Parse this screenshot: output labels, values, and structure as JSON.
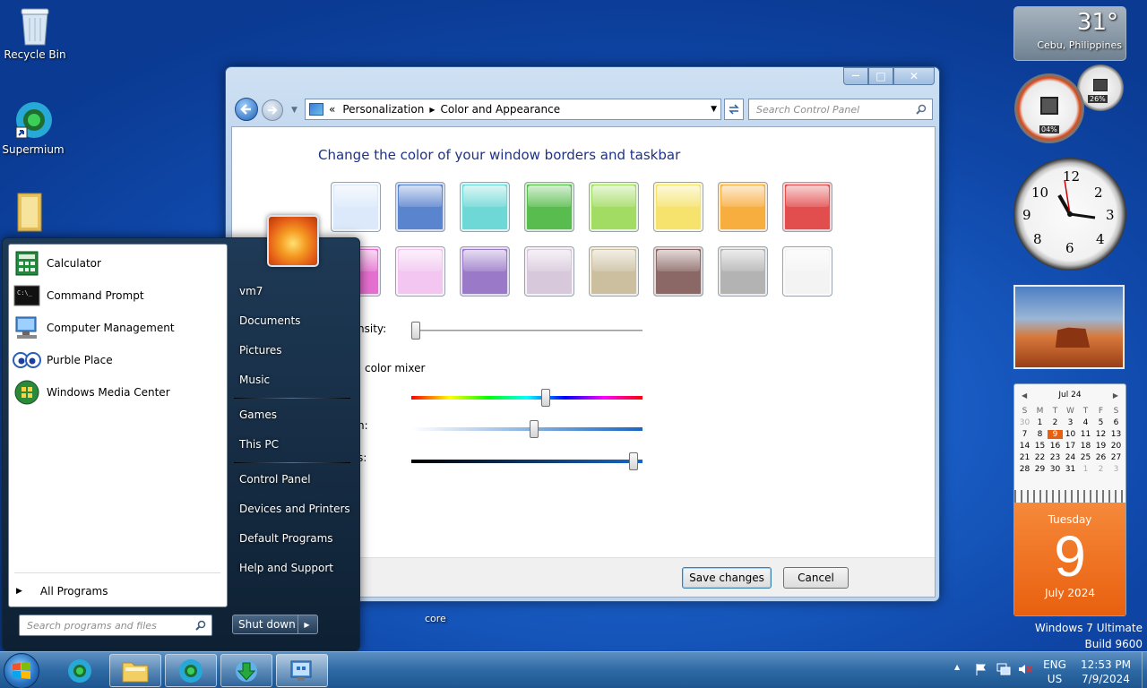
{
  "desktop": {
    "icons": [
      {
        "label": "Recycle Bin"
      },
      {
        "label": "Supermium"
      },
      {
        "label": ""
      }
    ],
    "core_label": "core",
    "watermark": {
      "line1": "Windows 7 Ultimate",
      "line2": "Build 9600"
    }
  },
  "window": {
    "breadcrumb": {
      "prefix": "«",
      "item1": "Personalization",
      "item2": "Color and Appearance"
    },
    "search_placeholder": "Search Control Panel",
    "heading": "Change the color of your window borders and taskbar",
    "swatches": [
      "#dbe9fb",
      "#5b84cf",
      "#6ed8d6",
      "#58bd4e",
      "#a2dc63",
      "#f5e36d",
      "#f8ad3f",
      "#e24d4d",
      "#e56fd0",
      "#f2c6f1",
      "#9a79c8",
      "#d8c8dc",
      "#cbbf9f",
      "#8b6865",
      "#b3b3b3",
      "#f3f3f3"
    ],
    "intensity_label": "nsity:",
    "mixer_label": "color mixer",
    "saturation_label": "n:",
    "brightness_label": "s:",
    "sliders": {
      "intensity": 0.02,
      "hue": 0.58,
      "saturation": 0.53,
      "brightness": 0.96
    },
    "save_button": "Save changes",
    "cancel_button": "Cancel",
    "controls": {
      "minimize": "—",
      "maximize": "□",
      "close": "✕"
    }
  },
  "start_menu": {
    "programs": [
      {
        "label": "Calculator",
        "icon": "calculator-icon"
      },
      {
        "label": "Command Prompt",
        "icon": "command-prompt-icon"
      },
      {
        "label": "Computer Management",
        "icon": "computer-management-icon"
      },
      {
        "label": "Purble Place",
        "icon": "purble-place-icon"
      },
      {
        "label": "Windows Media Center",
        "icon": "media-center-icon"
      }
    ],
    "all_programs": "All Programs",
    "search_placeholder": "Search programs and files",
    "right_items": [
      "vm7",
      "Documents",
      "Pictures",
      "Music",
      "Games",
      "This PC",
      "Control Panel",
      "Devices and Printers",
      "Default Programs",
      "Help and Support"
    ],
    "shutdown": "Shut down"
  },
  "gadgets": {
    "weather": {
      "temp": "31°",
      "location": "Cebu, Philippines"
    },
    "meter": {
      "cpu": "04%",
      "ram": "26%"
    },
    "calendar": {
      "month": "Jul 24",
      "days": [
        "S",
        "M",
        "T",
        "W",
        "T",
        "F",
        "S"
      ],
      "rows": [
        [
          "30",
          "1",
          "2",
          "3",
          "4",
          "5",
          "6"
        ],
        [
          "7",
          "8",
          "9",
          "10",
          "11",
          "12",
          "13"
        ],
        [
          "14",
          "15",
          "16",
          "17",
          "18",
          "19",
          "20"
        ],
        [
          "21",
          "22",
          "23",
          "24",
          "25",
          "26",
          "27"
        ],
        [
          "28",
          "29",
          "30",
          "31",
          "1",
          "2",
          "3"
        ]
      ],
      "weekday": "Tuesday",
      "day": "9",
      "month_year": "July 2024"
    },
    "clock": {
      "n12": "12",
      "n3": "3",
      "n6": "6",
      "n9": "9",
      "n10": "10",
      "n2": "2",
      "n4": "4",
      "n8": "8"
    }
  },
  "taskbar": {
    "lang": {
      "line1": "ENG",
      "line2": "US"
    },
    "clock": {
      "time": "12:53 PM",
      "date": "7/9/2024"
    }
  }
}
